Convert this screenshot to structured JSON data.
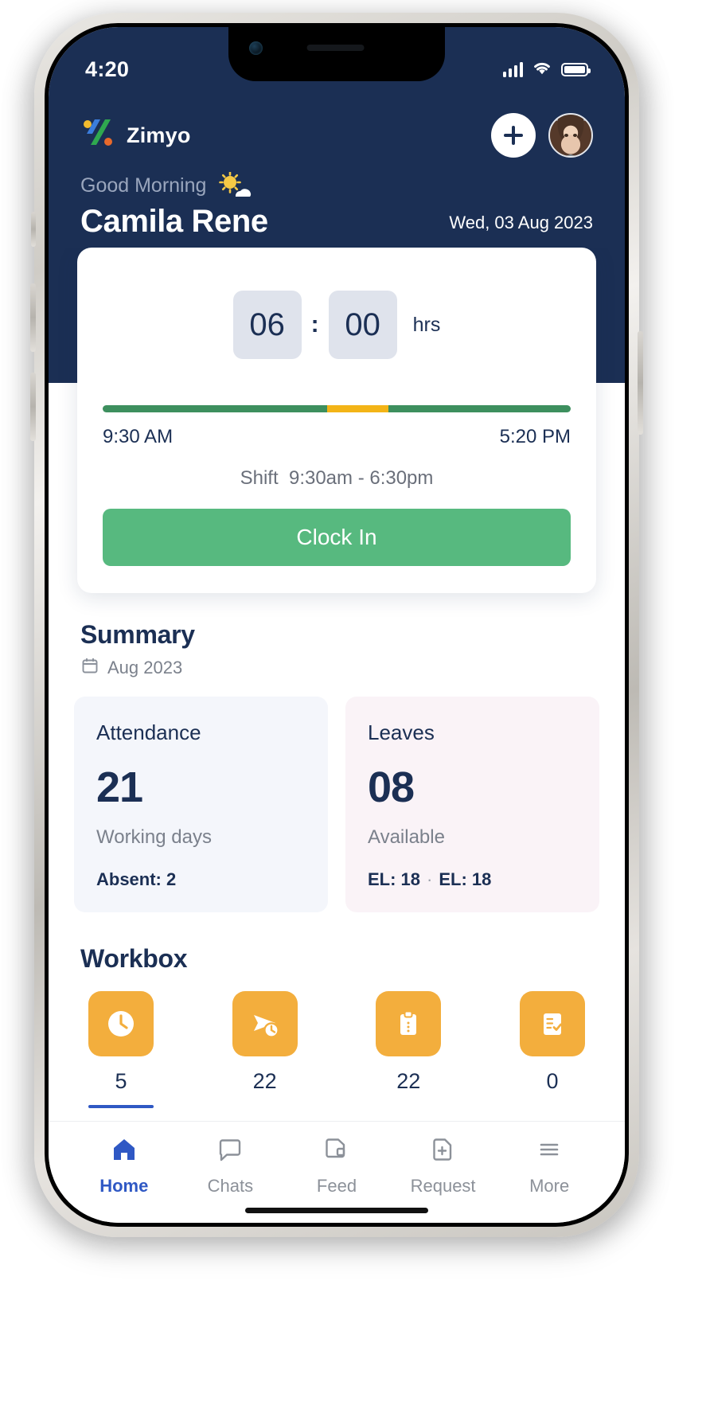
{
  "status_bar": {
    "time": "4:20",
    "signal_icon": "signal-bars-icon",
    "wifi_icon": "wifi-icon",
    "battery_icon": "battery-full-icon"
  },
  "header": {
    "brand_name": "Zimyo",
    "logo_icon": "zimyo-logo-icon",
    "add_button_icon": "plus-icon",
    "avatar_icon": "user-avatar",
    "greeting": "Good Morning",
    "greeting_icon": "sun-behind-cloud-icon",
    "user_name": "Camila Rene",
    "date": "Wed, 03 Aug 2023",
    "bg_color": "#1b2f54"
  },
  "clock_card": {
    "hours": "06",
    "separator": ":",
    "minutes": "00",
    "unit": "hrs",
    "progress": {
      "segments": [
        {
          "color": "#3d8f5e",
          "percent": 48
        },
        {
          "color": "#f3b417",
          "percent": 13
        },
        {
          "color": "#3d8f5e",
          "percent": 39
        }
      ]
    },
    "start_time": "9:30 AM",
    "end_time": "5:20 PM",
    "shift_label": "Shift",
    "shift_value": "9:30am - 6:30pm",
    "clock_in_label": "Clock In",
    "clock_in_color": "#57b97f"
  },
  "summary": {
    "title": "Summary",
    "calendar_icon": "calendar-icon",
    "month": "Aug 2023",
    "cards": [
      {
        "title": "Attendance",
        "value": "21",
        "subtitle": "Working days",
        "meta": "Absent: 2",
        "bg_color": "#f4f6fb"
      },
      {
        "title": "Leaves",
        "value": "08",
        "subtitle": "Available",
        "meta_left": "EL: 18",
        "meta_dot": "·",
        "meta_right": "EL: 18",
        "bg_color": "#faf3f7"
      }
    ]
  },
  "workbox": {
    "title": "Workbox",
    "items": [
      {
        "icon": "clock-icon",
        "count": "5",
        "active": true
      },
      {
        "icon": "send-pending-icon",
        "count": "22",
        "active": false
      },
      {
        "icon": "clipboard-icon",
        "count": "22",
        "active": false
      },
      {
        "icon": "clipboard-check-icon",
        "count": "0",
        "active": false
      }
    ],
    "icon_color": "#f3ae3d",
    "active_underline_color": "#2f58c4"
  },
  "bottom_nav": {
    "items": [
      {
        "label": "Home",
        "icon": "home-icon",
        "active": true
      },
      {
        "label": "Chats",
        "icon": "chat-bubble-icon",
        "active": false
      },
      {
        "label": "Feed",
        "icon": "feed-document-icon",
        "active": false
      },
      {
        "label": "Request",
        "icon": "request-file-plus-icon",
        "active": false
      },
      {
        "label": "More",
        "icon": "menu-hamburger-icon",
        "active": false
      }
    ],
    "active_color": "#2f58c4",
    "inactive_color": "#8c9199"
  }
}
